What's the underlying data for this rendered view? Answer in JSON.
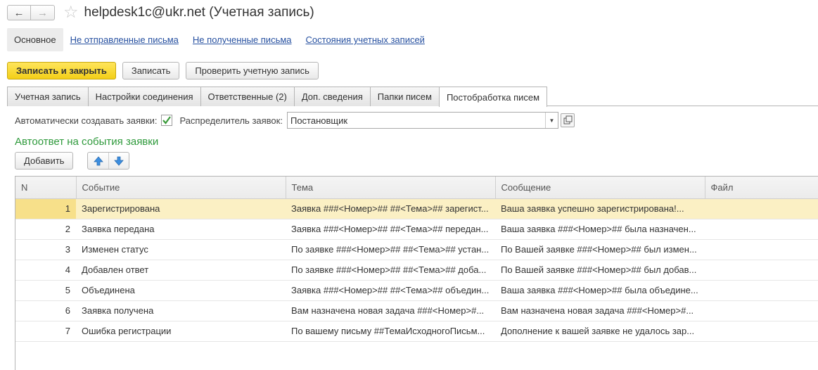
{
  "window": {
    "title": "helpdesk1c@ukr.net (Учетная запись)"
  },
  "nav": {
    "active": "Основное",
    "links": [
      "Не отправленные письма",
      "Не полученные письма",
      "Состояния учетных записей"
    ]
  },
  "toolbar": {
    "save_close": "Записать и закрыть",
    "save": "Записать",
    "check": "Проверить учетную запись"
  },
  "tabs": [
    "Учетная запись",
    "Настройки соединения",
    "Ответственные (2)",
    "Доп. сведения",
    "Папки писем",
    "Постобработка писем"
  ],
  "options": {
    "auto_label": "Автоматически создавать заявки:",
    "auto_checked": true,
    "distributor_label": "Распределитель заявок:",
    "distributor_value": "Постановщик"
  },
  "section": {
    "title": "Автоответ на события заявки",
    "add_label": "Добавить"
  },
  "table": {
    "columns": [
      "N",
      "Событие",
      "Тема",
      "Сообщение",
      "Файл"
    ],
    "rows": [
      {
        "n": "1",
        "event": "Зарегистрирована",
        "subject": "Заявка ###<Номер>## ##<Тема>## зарегист...",
        "message": "Ваша заявка успешно зарегистрирована!...",
        "file": ""
      },
      {
        "n": "2",
        "event": "Заявка передана",
        "subject": "Заявка ###<Номер>## ##<Тема>## передан...",
        "message": "Ваша заявка ###<Номер>## была назначен...",
        "file": ""
      },
      {
        "n": "3",
        "event": "Изменен статус",
        "subject": "По заявке ###<Номер>## ##<Тема>## устан...",
        "message": "По Вашей заявке ###<Номер>## был измен...",
        "file": ""
      },
      {
        "n": "4",
        "event": "Добавлен ответ",
        "subject": "По заявке ###<Номер>## ##<Тема>## доба...",
        "message": "По Вашей заявке ###<Номер>## был добав...",
        "file": ""
      },
      {
        "n": "5",
        "event": "Объединена",
        "subject": "Заявка ###<Номер>## ##<Тема>## объедин...",
        "message": "Ваша заявка ###<Номер>## была объедине...",
        "file": ""
      },
      {
        "n": "6",
        "event": "Заявка получена",
        "subject": "Вам назначена новая задача ###<Номер>#...",
        "message": "Вам назначена новая задача ###<Номер>#...",
        "file": ""
      },
      {
        "n": "7",
        "event": "Ошибка регистрации",
        "subject": "По вашему письму ##ТемаИсходногоПисьм...",
        "message": "Дополнение к вашей заявке не удалось зар...",
        "file": ""
      }
    ]
  },
  "colors": {
    "primary_button": "#f3cf18",
    "link": "#2650a0",
    "section_title": "#2f9a3c",
    "selected_row": "#fbf0c4",
    "arrow": "#3c8ee0",
    "checkmark": "#3a9a3a"
  },
  "icons": [
    "back-arrow-icon",
    "forward-arrow-icon",
    "star-icon",
    "checkmark-icon",
    "dropdown-arrow-icon",
    "open-icon",
    "move-up-icon",
    "move-down-icon"
  ]
}
